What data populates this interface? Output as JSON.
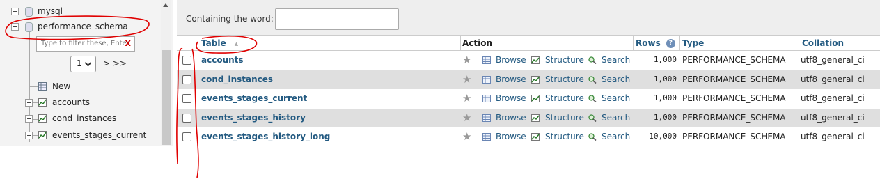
{
  "nav": {
    "items": [
      {
        "label": "mysql"
      },
      {
        "label": "performance_schema"
      }
    ],
    "filter_placeholder": "Type to filter these, Enter",
    "filter_clear": "X",
    "page_value": "1",
    "pager_next": "> >>",
    "new_label": "New",
    "tables": [
      {
        "label": "accounts"
      },
      {
        "label": "cond_instances"
      },
      {
        "label": "events_stages_current"
      }
    ]
  },
  "filterbar": {
    "label": "Containing the word:",
    "value": ""
  },
  "table": {
    "headers": {
      "table": "Table",
      "sort_indicator": "▲",
      "action": "Action",
      "rows": "Rows",
      "rows_help": "?",
      "type": "Type",
      "collation": "Collation"
    },
    "action_labels": {
      "browse": "Browse",
      "structure": "Structure",
      "search": "Search"
    },
    "rows": [
      {
        "name": "accounts",
        "rows": "1,000",
        "type": "PERFORMANCE_SCHEMA",
        "collation": "utf8_general_ci"
      },
      {
        "name": "cond_instances",
        "rows": "1,000",
        "type": "PERFORMANCE_SCHEMA",
        "collation": "utf8_general_ci"
      },
      {
        "name": "events_stages_current",
        "rows": "1,000",
        "type": "PERFORMANCE_SCHEMA",
        "collation": "utf8_general_ci"
      },
      {
        "name": "events_stages_history",
        "rows": "1,000",
        "type": "PERFORMANCE_SCHEMA",
        "collation": "utf8_general_ci"
      },
      {
        "name": "events_stages_history_long",
        "rows": "10,000",
        "type": "PERFORMANCE_SCHEMA",
        "collation": "utf8_general_ci"
      }
    ]
  },
  "colors": {
    "link": "#235a81",
    "row_alt": "#dfdfdf",
    "annotation": "#e00000"
  }
}
